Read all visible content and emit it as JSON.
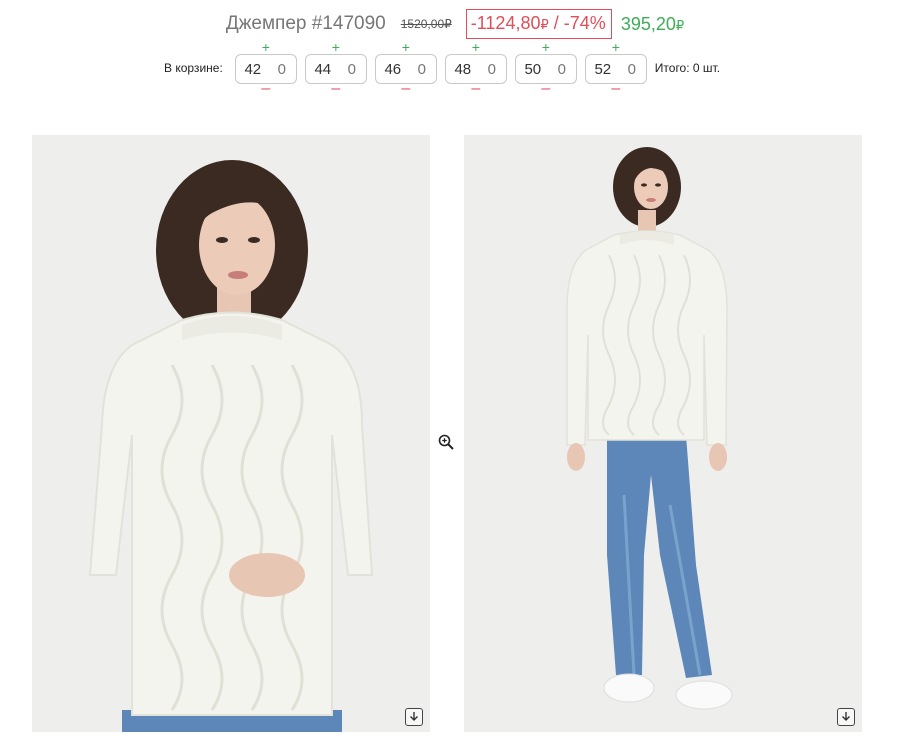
{
  "product": {
    "title": "Джемпер #147090",
    "old_price": "1520,00₽",
    "discount_amount": "-1124,80",
    "discount_currency": "₽",
    "discount_sep": " / ",
    "discount_percent": "-74%",
    "new_price": "395,20",
    "new_price_currency": "₽"
  },
  "cart": {
    "label": "В корзине:",
    "plus_symbol": "+",
    "minus_symbol": "–",
    "sizes": [
      {
        "size": "42",
        "qty": "0"
      },
      {
        "size": "44",
        "qty": "0"
      },
      {
        "size": "46",
        "qty": "0"
      },
      {
        "size": "48",
        "qty": "0"
      },
      {
        "size": "50",
        "qty": "0"
      },
      {
        "size": "52",
        "qty": "0"
      }
    ],
    "total": "Итого: 0 шт."
  },
  "icons": {
    "zoom": "zoom-in-icon",
    "download": "download-icon"
  },
  "colors": {
    "discount_red": "#e04e5a",
    "price_green": "#3fad57",
    "photo_bg": "#eeeeed",
    "sweater": "#f4f4ee",
    "hair": "#3a2a22",
    "jeans": "#5d87b8"
  }
}
